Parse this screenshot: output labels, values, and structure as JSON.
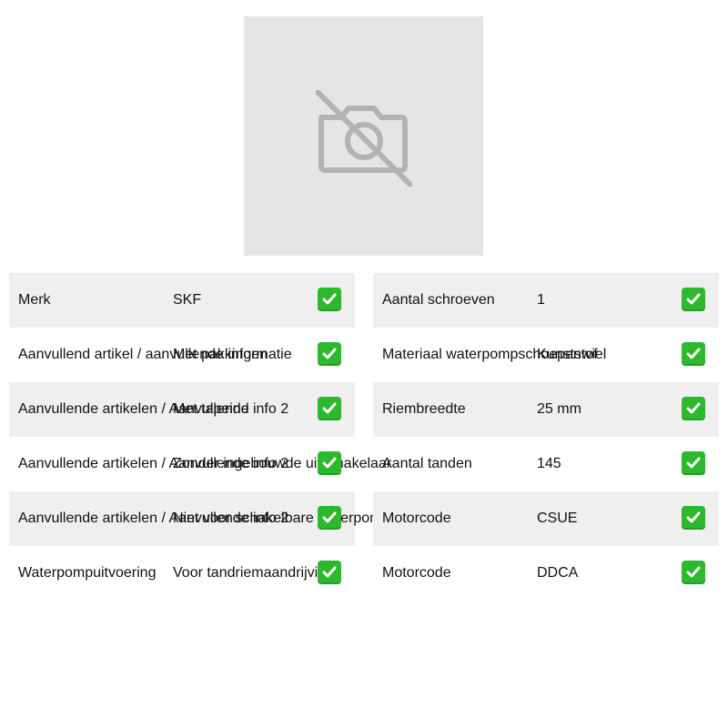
{
  "left_rows": [
    {
      "label": "Merk",
      "value": "SKF"
    },
    {
      "label": "Aanvullend artikel / aanvullende informatie",
      "value": "Met pakkingen"
    },
    {
      "label": "Aanvullende artikelen / Aanvullende info 2",
      "value": "Met tapeind"
    },
    {
      "label": "Aanvullende artikelen / Aanvullende info 2",
      "value": "Zonder ingebouwde uitschakelaar"
    },
    {
      "label": "Aanvullende artikelen / Aanvullende info 2",
      "value": "Niet voor schakelbare waterpomp"
    },
    {
      "label": "Waterpompuitvoering",
      "value": "Voor tandriemaandrijving"
    }
  ],
  "right_rows": [
    {
      "label": "Aantal schroeven",
      "value": "1"
    },
    {
      "label": "Materiaal waterpompschoepenwiel",
      "value": "Kunststof"
    },
    {
      "label": "Riembreedte",
      "value": "25 mm"
    },
    {
      "label": "Aantal tanden",
      "value": "145"
    },
    {
      "label": "Motorcode",
      "value": "CSUE"
    },
    {
      "label": "Motorcode",
      "value": "DDCA"
    }
  ],
  "icons": {
    "placeholder": "camera-off-icon",
    "check": "check-icon"
  },
  "colors": {
    "check": "#2db92d",
    "row_shade": "#efefef",
    "placeholder_bg": "#e5e5e5"
  }
}
